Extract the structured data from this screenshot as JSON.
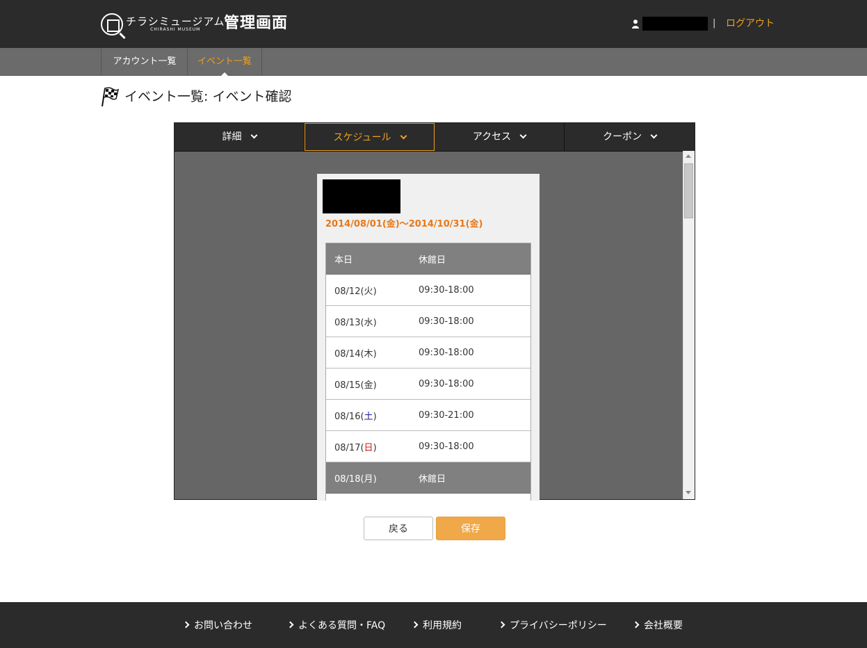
{
  "header": {
    "logo_jp": "チラシミュージアム",
    "logo_en": "CHIRASHI MUSEUM",
    "admin_title": "管理画面",
    "separator": "|",
    "logout_label": "ログアウト"
  },
  "nav": {
    "tabs": [
      {
        "label": "アカウント一覧"
      },
      {
        "label": "イベント一覧"
      }
    ]
  },
  "page": {
    "title": "イベント一覧: イベント確認"
  },
  "preview": {
    "tabs": [
      {
        "label": "詳細"
      },
      {
        "label": "スケジュール"
      },
      {
        "label": "アクセス"
      },
      {
        "label": "クーポン"
      }
    ],
    "date_range": "2014/08/01(金)〜2014/10/31(金)",
    "schedule_header": {
      "date": "本日",
      "hours": "休館日"
    },
    "schedule": [
      {
        "md": "08/12(",
        "dow": "火",
        "close": ")",
        "hours": "09:30-18:00"
      },
      {
        "md": "08/13(",
        "dow": "水",
        "close": ")",
        "hours": "09:30-18:00"
      },
      {
        "md": "08/14(",
        "dow": "木",
        "close": ")",
        "hours": "09:30-18:00"
      },
      {
        "md": "08/15(",
        "dow": "金",
        "close": ")",
        "hours": "09:30-18:00"
      },
      {
        "md": "08/16(",
        "dow": "土",
        "close": ")",
        "hours": "09:30-21:00"
      },
      {
        "md": "08/17(",
        "dow": "日",
        "close": ")",
        "hours": "09:30-18:00"
      },
      {
        "md": "08/18(",
        "dow": "月",
        "close": ")",
        "hours": "休館日"
      }
    ]
  },
  "buttons": {
    "back_label": "戻る",
    "save_label": "保存"
  },
  "footer": {
    "links": [
      {
        "label": "お問い合わせ"
      },
      {
        "label": "よくある質問・FAQ"
      },
      {
        "label": "利用規約"
      },
      {
        "label": "プライバシーポリシー"
      },
      {
        "label": "会社概要"
      }
    ]
  },
  "colors": {
    "accent": "#f0a020",
    "header_bg": "#2b2b2b",
    "nav_bg": "#6b6b6b",
    "date_orange": "#e87818",
    "saturday_blue": "#1a1aa0",
    "sunday_red": "#c81818",
    "save_button": "#f0a848"
  }
}
